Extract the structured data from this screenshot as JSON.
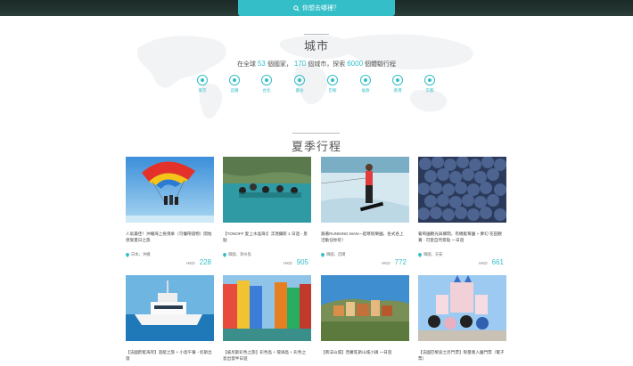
{
  "header": {
    "search_label": "你想去哪裡？"
  },
  "cities_section": {
    "title": "城市",
    "stats_prefix": "在全球",
    "countries_count": "53",
    "countries_label": "個國家，",
    "cities_count": "170",
    "cities_label": "個城市，探索",
    "experiences_count": "6000",
    "experiences_label": "個體驗行程",
    "cities": [
      "東京",
      "首爾",
      "台北",
      "曼谷",
      "巴黎",
      "倫敦",
      "香港",
      "京都"
    ]
  },
  "summer_section": {
    "title": "夏季行程",
    "currency": "HKD",
    "cards": [
      {
        "title": "人氣最佳！沖繩海上拖曳傘（可攜帶錢物）開始感受夏日之旅",
        "location": "日本，沖繩",
        "price": "228"
      },
      {
        "title": "【TONOFF 愛上水晶灣!】浮潛攝影 1 日遊 - 景點",
        "location": "韓國，濟州島",
        "price": "905"
      },
      {
        "title": "跟著RUNNING MAN一起寒假樂園，各式各上活動任你玩！",
        "location": "韓國，首爾",
        "price": "772"
      },
      {
        "title": "葡萄園觀光與鄉間，有機藍莓園 + 夢幻 花田觀賞 - 可愛自然景點 一日遊",
        "location": "韓國，天安",
        "price": "661"
      },
      {
        "title": "【法國蔚藍海岸】遊艇之旅 + 小島午餐 - 尼斯出發",
        "location": "",
        "price": ""
      },
      {
        "title": "【威尼斯彩色之旅】彩色島 + 玻璃島 + 彩色之島出發半日遊",
        "location": "",
        "price": ""
      },
      {
        "title": "【南法山城】普羅旺斯山城小鎮 一日遊",
        "location": "",
        "price": ""
      },
      {
        "title": "【法國巴黎迪士尼門票】限量版入園門票（電子票）",
        "location": "",
        "price": ""
      }
    ]
  },
  "colors": {
    "accent": "#33bec8"
  }
}
